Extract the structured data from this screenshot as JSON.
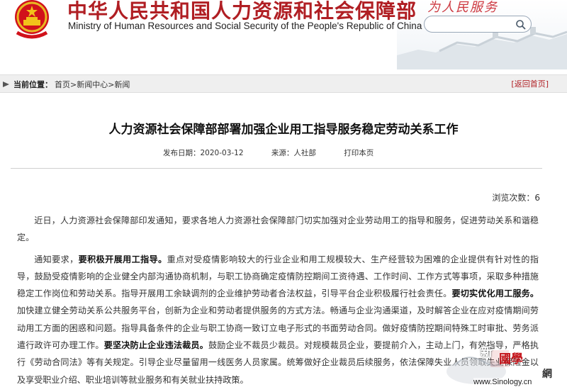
{
  "header": {
    "site_name_cn": "中华人民共和国人力资源和社会保障部",
    "site_name_en": "Ministry of Human Resources and Social Security of the People's Republic of China",
    "slogan": "为人民服务",
    "emblem_icon": "national-emblem-icon",
    "search": {
      "placeholder": "",
      "button_icon": "search-icon"
    },
    "colors": {
      "brand_red": "#b01e23"
    }
  },
  "breadcrumb": {
    "label": "当前位置：",
    "items": [
      "首页",
      "新闻中心",
      "新闻"
    ],
    "separator": ">",
    "back_label": "[返回首页]"
  },
  "article": {
    "title": "人力资源社会保障部部署加强企业用工指导服务稳定劳动关系工作",
    "publish_date": "发布日期：2020-03-12",
    "source": "来源：人社部",
    "print_label": "打印本页",
    "views": "浏览次数：6",
    "paragraphs": [
      [
        {
          "t": "近日，人力资源社会保障部印发通知，要求各地人力资源社会保障部门切实加强对企业劳动用工的指导和服务，促进劳动关系和谐稳定。",
          "b": false
        }
      ],
      [
        {
          "t": "通知要求，",
          "b": false
        },
        {
          "t": "要积极开展用工指导。",
          "b": true
        },
        {
          "t": "重点对受疫情影响较大的行业企业和用工规模较大、生产经营较为困难的企业提供有针对性的指导，鼓励受疫情影响的企业健全内部沟通协商机制，与职工协商确定疫情防控期间工资待遇、工作时间、工作方式等事项，采取多种措施稳定工作岗位和劳动关系。指导开展用工余缺调剂的企业维护劳动者合法权益，引导平台企业积极履行社会责任。",
          "b": false
        },
        {
          "t": "要切实优化用工服务。",
          "b": true
        },
        {
          "t": "加快建立健全劳动关系公共服务平台，创新为企业和劳动者提供服务的方式方法。畅通与企业沟通渠道，及时解答企业在应对疫情期间劳动用工方面的困惑和问题。指导具备条件的企业与职工协商一致订立电子形式的书面劳动合同。做好疫情防控期间特殊工时审批、劳务派遣行政许可办理工作。",
          "b": false
        },
        {
          "t": "要坚决防止企业违法裁员。",
          "b": true
        },
        {
          "t": "鼓励企业不裁员少裁员。对规模裁员企业，要提前介入，主动上门，有效指导，严格执行《劳动合同法》等有关规定。引导企业尽量留用一线医务人员家属。统筹做好企业裁员后续服务，依法保障失业人员领取失业保险金以及享受职业介绍、职业培训等就业服务和有关就业扶持政策。",
          "b": false
        }
      ]
    ]
  },
  "watermark": {
    "chars_1": "新",
    "chars_2": "國學",
    "chars_3": "網",
    "url": "www.Sinology.cn"
  }
}
